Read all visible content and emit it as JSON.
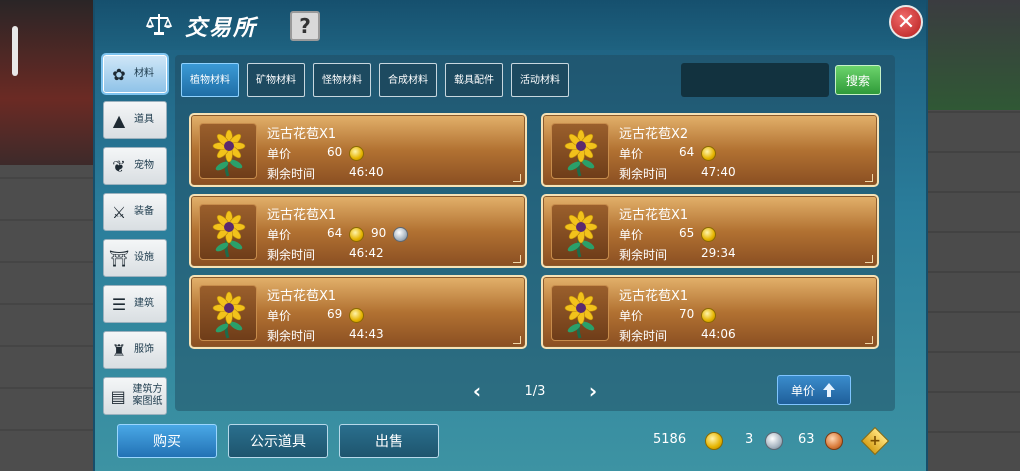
{
  "window": {
    "title": "交易所",
    "help_label": "?",
    "close_label": "✕"
  },
  "nav": {
    "items": [
      {
        "label": "材料",
        "icon": "materials-icon",
        "active": true
      },
      {
        "label": "道具",
        "icon": "item-icon",
        "active": false
      },
      {
        "label": "宠物",
        "icon": "pet-paw-icon",
        "active": false
      },
      {
        "label": "装备",
        "icon": "equipment-icon",
        "active": false
      },
      {
        "label": "设施",
        "icon": "facility-icon",
        "active": false
      },
      {
        "label": "建筑",
        "icon": "building-icon",
        "active": false
      },
      {
        "label": "服饰",
        "icon": "clothing-icon",
        "active": false
      },
      {
        "label": "建筑方案图纸",
        "icon": "blueprint-icon",
        "active": false
      }
    ]
  },
  "tabs": [
    {
      "label": "植物材料",
      "active": true
    },
    {
      "label": "矿物材料",
      "active": false
    },
    {
      "label": "怪物材料",
      "active": false
    },
    {
      "label": "合成材料",
      "active": false
    },
    {
      "label": "载具配件",
      "active": false
    },
    {
      "label": "活动材料",
      "active": false
    }
  ],
  "search": {
    "value": "",
    "placeholder": "",
    "button_label": "搜索"
  },
  "listings": [
    {
      "name": "远古花苞X1",
      "price_label": "单价",
      "gold": "60",
      "time_label": "剩余时间",
      "time": "46:40"
    },
    {
      "name": "远古花苞X2",
      "price_label": "单价",
      "gold": "64",
      "time_label": "剩余时间",
      "time": "47:40"
    },
    {
      "name": "远古花苞X1",
      "price_label": "单价",
      "gold": "64",
      "silver": "90",
      "time_label": "剩余时间",
      "time": "46:42"
    },
    {
      "name": "远古花苞X1",
      "price_label": "单价",
      "gold": "65",
      "time_label": "剩余时间",
      "time": "29:34"
    },
    {
      "name": "远古花苞X1",
      "price_label": "单价",
      "gold": "69",
      "time_label": "剩余时间",
      "time": "44:43"
    },
    {
      "name": "远古花苞X1",
      "price_label": "单价",
      "gold": "70",
      "time_label": "剩余时间",
      "time": "44:06"
    }
  ],
  "pager": {
    "text": "1/3"
  },
  "sort": {
    "label": "单价"
  },
  "bottom": {
    "buy_label": "购买",
    "public_label": "公示道具",
    "sell_label": "出售",
    "gold_amount": "5186",
    "silver_amount": "3",
    "bronze_amount": "63"
  },
  "colors": {
    "accent": "#2a7d9b",
    "card": "#b27232",
    "search_button": "#2f9a39"
  }
}
